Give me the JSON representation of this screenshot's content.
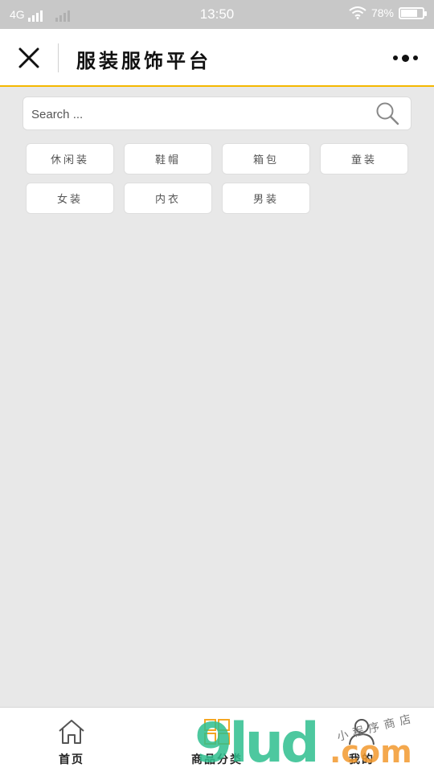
{
  "status_bar": {
    "network": "4G",
    "time": "13:50",
    "battery": "78%",
    "battery_level": 0.78
  },
  "header": {
    "title": "服装服饰平台",
    "close_icon": "close-icon",
    "more_icon": "more-icon"
  },
  "search": {
    "placeholder": "Search ...",
    "icon": "search-icon"
  },
  "categories": [
    {
      "label": "休闲装"
    },
    {
      "label": "鞋帽"
    },
    {
      "label": "箱包"
    },
    {
      "label": "童装"
    },
    {
      "label": "女装"
    },
    {
      "label": "内衣"
    },
    {
      "label": "男装"
    }
  ],
  "tabbar": {
    "items": [
      {
        "label": "首页",
        "icon": "home-icon"
      },
      {
        "label": "商品分类",
        "icon": "grid-icon"
      },
      {
        "label": "我的",
        "icon": "user-icon"
      }
    ]
  },
  "watermark": {
    "brand": "9lud",
    "domain": ".com",
    "slogan": "小程序商店"
  },
  "colors": {
    "accent": "#f5b800",
    "background": "#e8e8e8",
    "statusbar": "#c8c8c8"
  }
}
